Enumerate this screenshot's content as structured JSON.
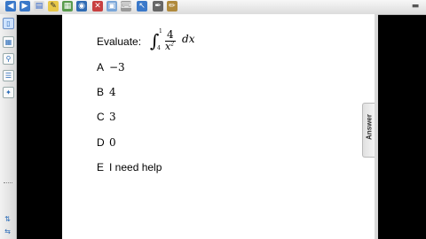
{
  "toolbar": {
    "icons": [
      "back-icon",
      "forward-icon",
      "page-icon",
      "note-icon",
      "grid-icon",
      "camera-icon",
      "delete-icon",
      "screen-icon",
      "keyboard-icon",
      "arrow-icon",
      "pen-icon",
      "pencil-icon"
    ],
    "menu_glyph": "▬"
  },
  "sidebar": {
    "icons": [
      "page-sorter-icon",
      "gallery-icon",
      "attachments-icon",
      "properties-icon",
      "addons-icon"
    ],
    "bottom_icons": [
      "move-up-icon",
      "move-down-icon"
    ]
  },
  "question": {
    "prompt": "Evaluate:",
    "integral": {
      "upper": "1",
      "lower": "4",
      "numerator": "4",
      "denominator_var": "x",
      "exponent": "2",
      "differential": "dx",
      "sign": "∫"
    }
  },
  "choices": [
    {
      "letter": "A",
      "value": "−3"
    },
    {
      "letter": "B",
      "value": "4"
    },
    {
      "letter": "C",
      "value": "3"
    },
    {
      "letter": "D",
      "value": "0"
    },
    {
      "letter": "E",
      "value": "I need help"
    }
  ],
  "answer_tab": {
    "label": "Answer"
  }
}
